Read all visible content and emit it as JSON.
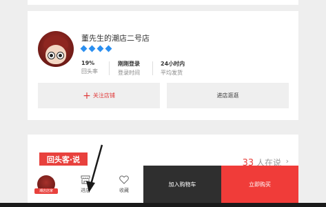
{
  "shop": {
    "name": "董先生的潮店二号店",
    "stats": [
      {
        "value": "19%",
        "label": "回头率"
      },
      {
        "value": "刚刚登录",
        "label": "登录时间"
      },
      {
        "value": "24小时内",
        "label": "平均发货"
      }
    ],
    "follow_label": "关注店铺",
    "visit_label": "进店逛逛"
  },
  "review": {
    "tag": "回头客·说",
    "online_count": "33",
    "online_suffix": "人在说"
  },
  "bottombar": {
    "avatar_badge": "潮店店家",
    "store_label": "进店",
    "favorite_label": "收藏",
    "cart_label": "加入购物车",
    "buy_label": "立即购买"
  },
  "colors": {
    "accent": "#e8413d",
    "diamond": "#2b8ff0",
    "cart_bg": "#2f2f2f",
    "buy_bg": "#f03c39"
  }
}
